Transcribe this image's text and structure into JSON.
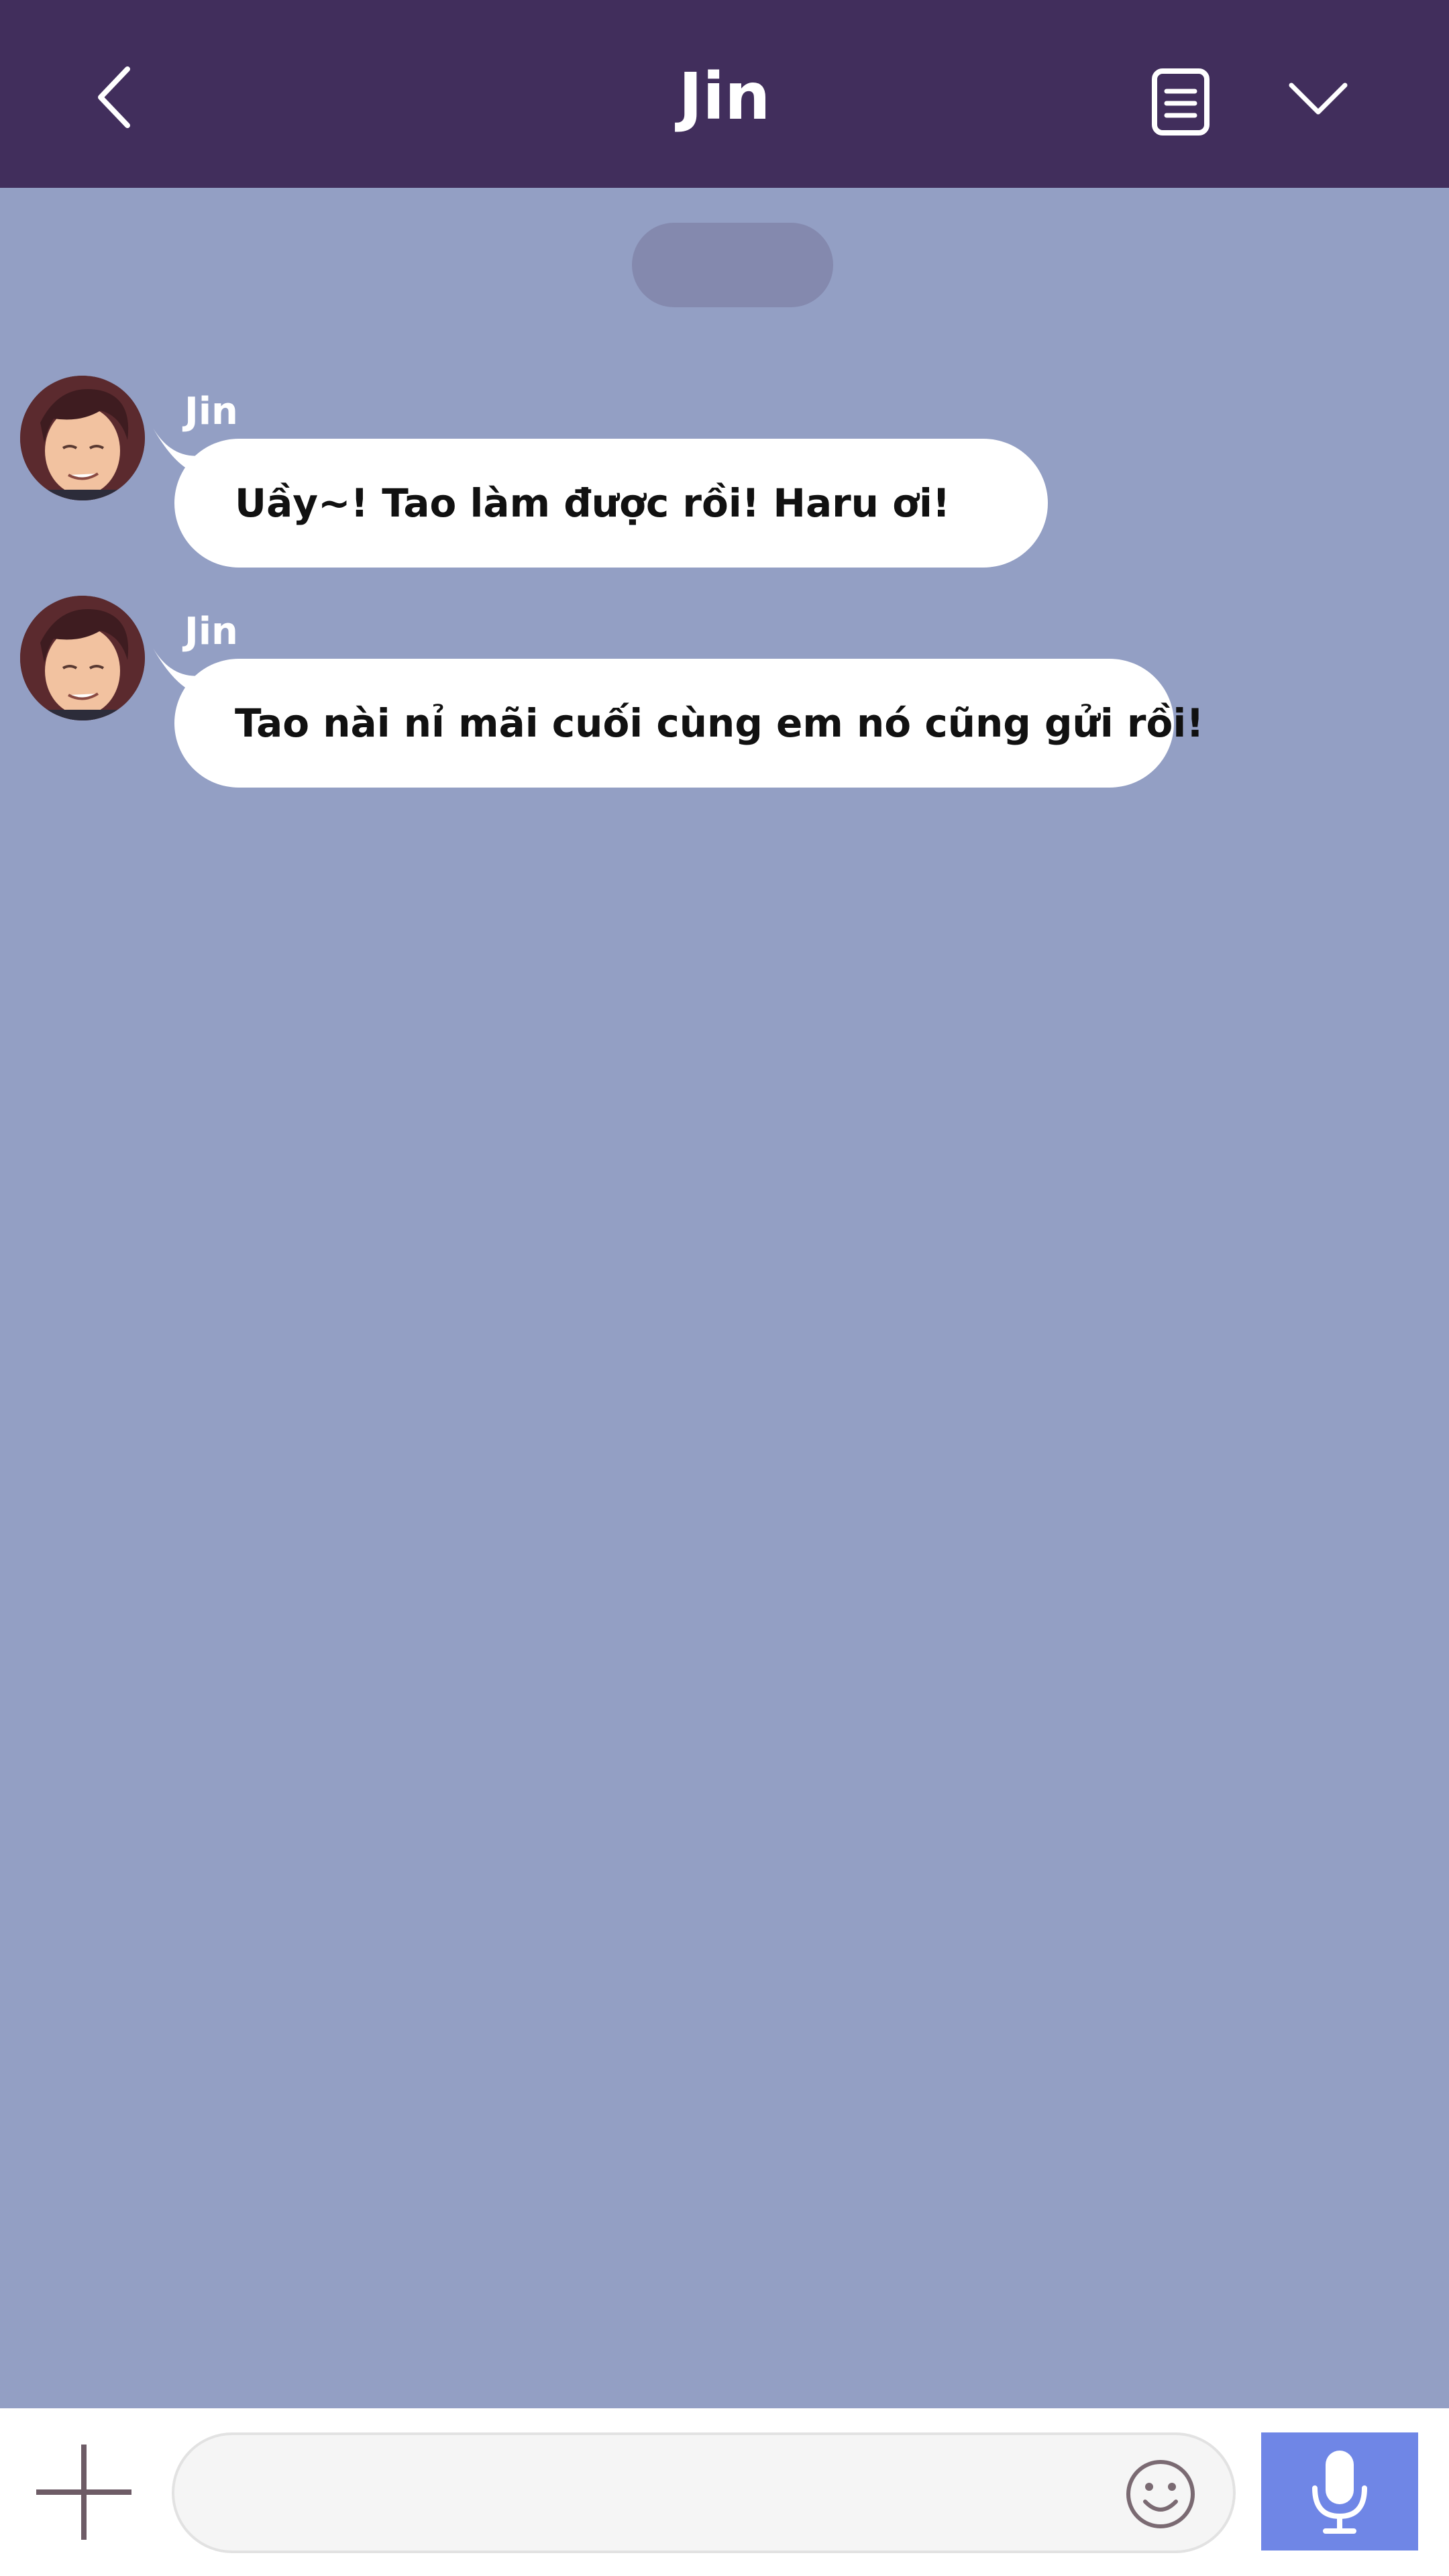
{
  "header": {
    "title": "Jin",
    "back_icon": "chevron-left-icon",
    "notes_icon": "document-icon",
    "collapse_icon": "chevron-down-icon"
  },
  "messages": [
    {
      "sender": "Jin",
      "text": "Uầy~! Tao làm được rồi! Haru ơi!"
    },
    {
      "sender": "Jin",
      "text": "Tao nài nỉ mãi cuối cùng em nó cũng gửi rồi!"
    }
  ],
  "input_bar": {
    "add_icon": "plus-icon",
    "emoji_icon": "smiley-icon",
    "mic_icon": "microphone-icon",
    "placeholder": ""
  },
  "colors": {
    "header_bg": "#412e5c",
    "chat_bg": "#939fc4",
    "bubble_bg": "#ffffff",
    "mic_bg": "#6f86e6"
  }
}
